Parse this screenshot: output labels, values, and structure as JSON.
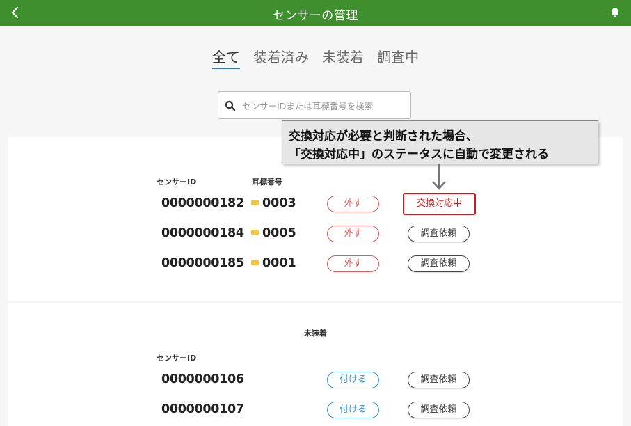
{
  "header": {
    "title": "センサーの管理",
    "back_icon": "chevron-left-icon",
    "bell_icon": "bell-icon",
    "color": "#3f8f2e"
  },
  "tabs": [
    {
      "label": "全て",
      "active": true
    },
    {
      "label": "装着済み",
      "active": false
    },
    {
      "label": "未装着",
      "active": false
    },
    {
      "label": "調査中",
      "active": false
    }
  ],
  "search": {
    "placeholder": "センサーIDまたは耳標番号を検索",
    "value": ""
  },
  "callout": {
    "line1": "交換対応が必要と判断された場合、",
    "line2": "「交換対応中」のステータスに自動で変更される"
  },
  "mounted": {
    "col_sensor_id": "センサーID",
    "col_ear_tag": "耳標番号",
    "rows": [
      {
        "sensor_id": "0000000182",
        "ear_tag": "0003",
        "remove_label": "外す",
        "status_label": "交換対応中"
      },
      {
        "sensor_id": "0000000184",
        "ear_tag": "0005",
        "remove_label": "外す",
        "status_label": "調査依頼"
      },
      {
        "sensor_id": "0000000185",
        "ear_tag": "0001",
        "remove_label": "外す",
        "status_label": "調査依頼"
      }
    ]
  },
  "unmounted": {
    "section_label": "未装着",
    "col_sensor_id": "センサーID",
    "rows": [
      {
        "sensor_id": "0000000106",
        "attach_label": "付ける",
        "status_label": "調査依頼"
      },
      {
        "sensor_id": "0000000107",
        "attach_label": "付ける",
        "status_label": "調査依頼"
      }
    ]
  },
  "colors": {
    "remove": "#e05a5a",
    "attach": "#3b98d9",
    "exchange": "#d21a1a",
    "active_tab_underline": "#2a7bbf"
  }
}
